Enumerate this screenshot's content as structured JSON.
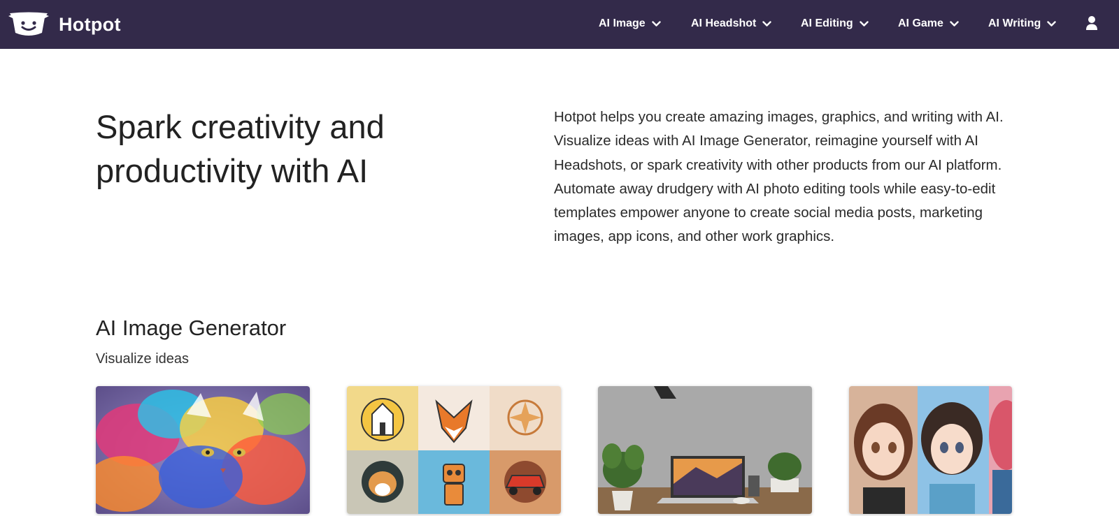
{
  "brand": {
    "name": "Hotpot",
    "logo_icon": "hotpot-face-logo"
  },
  "nav": {
    "items": [
      {
        "label": "AI Image"
      },
      {
        "label": "AI Headshot"
      },
      {
        "label": "AI Editing"
      },
      {
        "label": "AI Game"
      },
      {
        "label": "AI Writing"
      }
    ],
    "account_icon": "user-icon"
  },
  "hero": {
    "title": "Spark creativity and productivity with AI",
    "description": "Hotpot helps you create amazing images, graphics, and writing with AI. Visualize ideas with AI Image Generator, reimagine yourself with AI Headshots, or spark creativity with other products from our AI platform. Automate away drudgery with AI photo editing tools while easy-to-edit templates empower anyone to create social media posts, marketing images, app icons, and other work graphics."
  },
  "section": {
    "title": "AI Image Generator",
    "subtitle": "Visualize ideas",
    "cards": [
      {
        "image": "colorful-smoke-cat"
      },
      {
        "image": "logo-icon-grid"
      },
      {
        "image": "laptop-desk-workspace"
      },
      {
        "image": "anime-portraits"
      }
    ]
  },
  "colors": {
    "nav_background": "#332a4a",
    "nav_text": "#ffffff",
    "page_background": "#ffffff"
  }
}
